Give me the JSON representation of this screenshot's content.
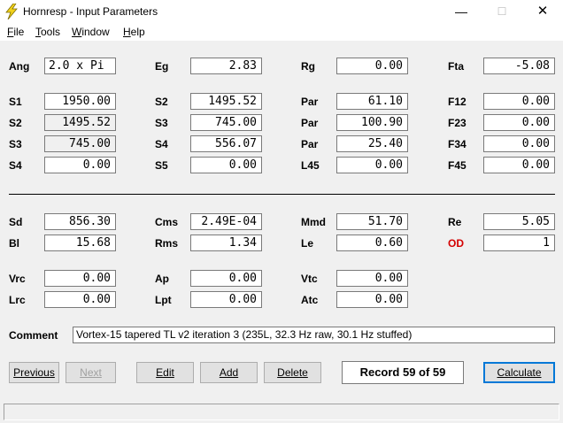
{
  "window": {
    "title": "Hornresp - Input Parameters",
    "minimize_glyph": "—",
    "maximize_glyph": "☐",
    "close_glyph": "✕"
  },
  "menu": {
    "items": [
      {
        "label": "File",
        "mnemonic": "F",
        "rest": "ile"
      },
      {
        "label": "Tools",
        "mnemonic": "T",
        "rest": "ools"
      },
      {
        "label": "Window",
        "mnemonic": "W",
        "rest": "indow"
      },
      {
        "label": "Help",
        "mnemonic": "H",
        "rest": "elp"
      }
    ]
  },
  "params": {
    "ang": {
      "label": "Ang",
      "value": "2.0 x Pi"
    },
    "eg": {
      "label": "Eg",
      "value": "2.83"
    },
    "rg": {
      "label": "Rg",
      "value": "0.00"
    },
    "fta": {
      "label": "Fta",
      "value": "-5.08"
    },
    "s1": {
      "label": "S1",
      "value": "1950.00"
    },
    "s2a": {
      "label": "S2",
      "value": "1495.52"
    },
    "par1": {
      "label": "Par",
      "value": "61.10"
    },
    "f12": {
      "label": "F12",
      "value": "0.00"
    },
    "s2b": {
      "label": "S2",
      "value": "1495.52"
    },
    "s3a": {
      "label": "S3",
      "value": "745.00"
    },
    "par2": {
      "label": "Par",
      "value": "100.90"
    },
    "f23": {
      "label": "F23",
      "value": "0.00"
    },
    "s3b": {
      "label": "S3",
      "value": "745.00"
    },
    "s4a": {
      "label": "S4",
      "value": "556.07"
    },
    "par3": {
      "label": "Par",
      "value": "25.40"
    },
    "f34": {
      "label": "F34",
      "value": "0.00"
    },
    "s4b": {
      "label": "S4",
      "value": "0.00"
    },
    "s5": {
      "label": "S5",
      "value": "0.00"
    },
    "l45": {
      "label": "L45",
      "value": "0.00"
    },
    "f45": {
      "label": "F45",
      "value": "0.00"
    },
    "sd": {
      "label": "Sd",
      "value": "856.30"
    },
    "cms": {
      "label": "Cms",
      "value": "2.49E-04"
    },
    "mmd": {
      "label": "Mmd",
      "value": "51.70"
    },
    "re": {
      "label": "Re",
      "value": "5.05"
    },
    "bl": {
      "label": "Bl",
      "value": "15.68"
    },
    "rms": {
      "label": "Rms",
      "value": "1.34"
    },
    "le": {
      "label": "Le",
      "value": "0.60"
    },
    "od": {
      "label": "OD",
      "value": "1"
    },
    "vrc": {
      "label": "Vrc",
      "value": "0.00"
    },
    "ap": {
      "label": "Ap",
      "value": "0.00"
    },
    "vtc": {
      "label": "Vtc",
      "value": "0.00"
    },
    "lrc": {
      "label": "Lrc",
      "value": "0.00"
    },
    "lpt": {
      "label": "Lpt",
      "value": "0.00"
    },
    "atc": {
      "label": "Atc",
      "value": "0.00"
    }
  },
  "comment": {
    "label": "Comment",
    "value": "Vortex-15 tapered TL v2 iteration 3 (235L, 32.3 Hz raw, 30.1 Hz stuffed)"
  },
  "buttons": {
    "previous": "Previous",
    "next": "Next",
    "edit": "Edit",
    "add": "Add",
    "delete": "Delete",
    "calculate": "Calculate"
  },
  "record": "Record 59 of 59",
  "colors": {
    "accent_red": "#d40000",
    "focus_blue": "#0078d7",
    "icon_yellow": "#f2d21b"
  }
}
